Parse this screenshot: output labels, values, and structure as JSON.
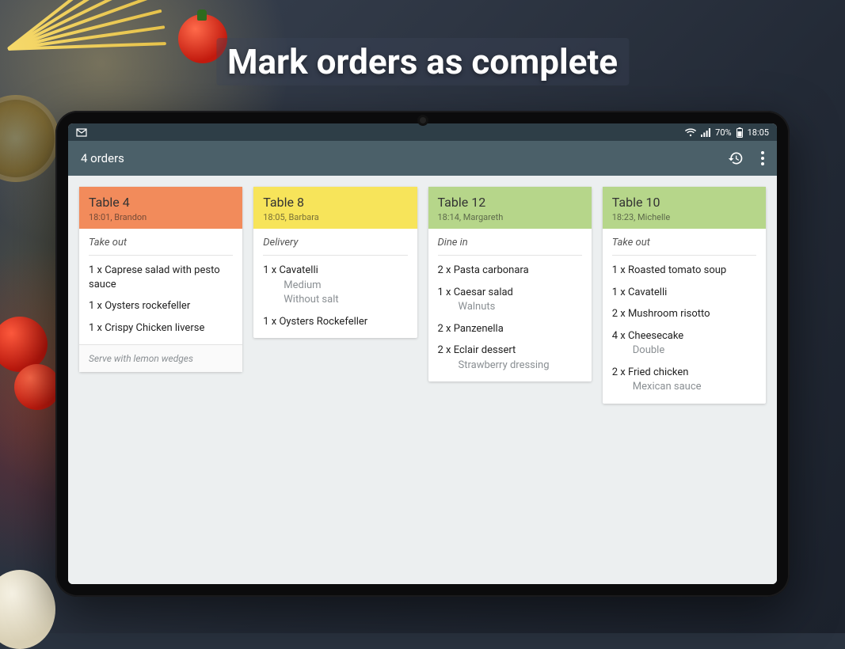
{
  "heading": "Mark orders as complete",
  "status": {
    "battery": "70%",
    "time": "18:05"
  },
  "appbar": {
    "title": "4 orders"
  },
  "orders": [
    {
      "table": "Table 4",
      "time": "18:01",
      "server": "Brandon",
      "headClass": "head-orange",
      "service": "Take out",
      "items": [
        {
          "main": "1 x Caprese salad with pesto sauce"
        },
        {
          "main": "1 x Oysters rockefeller"
        },
        {
          "main": "1 x Crispy Chicken liverse"
        }
      ],
      "note": "Serve with lemon wedges"
    },
    {
      "table": "Table 8",
      "time": "18:05",
      "server": "Barbara",
      "headClass": "head-yellow",
      "service": "Delivery",
      "items": [
        {
          "main": "1 x Cavatelli",
          "subs": [
            "Medium",
            "Without salt"
          ]
        },
        {
          "main": "1 x Oysters Rockefeller"
        }
      ]
    },
    {
      "table": "Table 12",
      "time": "18:14",
      "server": "Margareth",
      "headClass": "head-green",
      "service": "Dine in",
      "items": [
        {
          "main": "2 x Pasta carbonara"
        },
        {
          "main": "1 x Caesar salad",
          "subs": [
            "Walnuts"
          ]
        },
        {
          "main": "2 x Panzenella"
        },
        {
          "main": "2 x Eclair dessert",
          "subs": [
            "Strawberry dressing"
          ]
        }
      ]
    },
    {
      "table": "Table 10",
      "time": "18:23",
      "server": "Michelle",
      "headClass": "head-green",
      "service": "Take out",
      "items": [
        {
          "main": "1 x Roasted tomato soup"
        },
        {
          "main": "1 x Cavatelli"
        },
        {
          "main": "2 x Mushroom risotto"
        },
        {
          "main": "4 x Cheesecake",
          "subs": [
            "Double"
          ]
        },
        {
          "main": "2 x Fried chicken",
          "subs": [
            "Mexican sauce"
          ]
        }
      ]
    }
  ]
}
